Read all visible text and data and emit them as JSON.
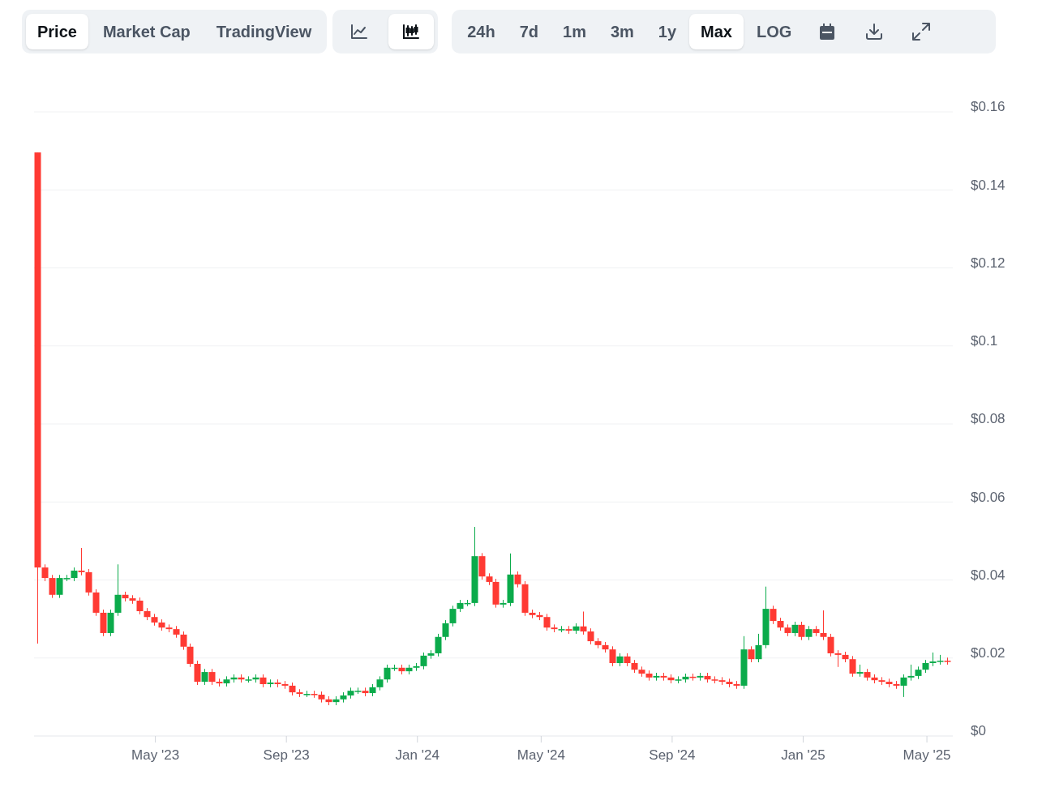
{
  "view_tabs": [
    {
      "label": "Price",
      "selected": true
    },
    {
      "label": "Market Cap",
      "selected": false
    },
    {
      "label": "TradingView",
      "selected": false
    }
  ],
  "chart_type_buttons": [
    {
      "kind": "line",
      "selected": false
    },
    {
      "kind": "candlestick",
      "selected": true
    }
  ],
  "range_tabs": [
    {
      "label": "24h",
      "selected": false
    },
    {
      "label": "7d",
      "selected": false
    },
    {
      "label": "1m",
      "selected": false
    },
    {
      "label": "3m",
      "selected": false
    },
    {
      "label": "1y",
      "selected": false
    },
    {
      "label": "Max",
      "selected": true
    },
    {
      "label": "LOG",
      "selected": false
    }
  ],
  "tool_buttons": [
    {
      "kind": "calendar"
    },
    {
      "kind": "download"
    },
    {
      "kind": "fullscreen"
    }
  ],
  "chart": {
    "chart_data": {
      "type": "candlestick",
      "grid": true,
      "ylim": [
        0,
        0.16
      ],
      "yticks": [
        {
          "value": 0.16,
          "label": "$0.16"
        },
        {
          "value": 0.14,
          "label": "$0.14"
        },
        {
          "value": 0.12,
          "label": "$0.12"
        },
        {
          "value": 0.1,
          "label": "$0.1"
        },
        {
          "value": 0.08,
          "label": "$0.08"
        },
        {
          "value": 0.06,
          "label": "$0.06"
        },
        {
          "value": 0.04,
          "label": "$0.04"
        },
        {
          "value": 0.02,
          "label": "$0.02"
        },
        {
          "value": 0,
          "label": "$0"
        }
      ],
      "categories": [
        null,
        null,
        null,
        null,
        null,
        null,
        null,
        null,
        null,
        null,
        null,
        null,
        null,
        null,
        null,
        null,
        "May '23",
        null,
        null,
        null,
        null,
        null,
        null,
        null,
        null,
        null,
        null,
        null,
        null,
        null,
        null,
        null,
        null,
        null,
        "Sep '23",
        null,
        null,
        null,
        null,
        null,
        null,
        null,
        null,
        null,
        null,
        null,
        null,
        null,
        null,
        null,
        null,
        null,
        "Jan '24",
        null,
        null,
        null,
        null,
        null,
        null,
        null,
        null,
        null,
        null,
        null,
        null,
        null,
        null,
        null,
        null,
        "May '24",
        null,
        null,
        null,
        null,
        null,
        null,
        null,
        null,
        null,
        null,
        null,
        null,
        null,
        null,
        null,
        null,
        null,
        "Sep '24",
        null,
        null,
        null,
        null,
        null,
        null,
        null,
        null,
        null,
        null,
        null,
        null,
        null,
        null,
        null,
        null,
        null,
        "Jan '25",
        null,
        null,
        null,
        null,
        null,
        null,
        null,
        null,
        null,
        null,
        null,
        null,
        null,
        null,
        null,
        null,
        "May '25",
        null,
        null,
        null
      ],
      "ohlc": [
        [
          0.1496,
          0.1496,
          0.0237,
          0.0432
        ],
        [
          0.0432,
          0.044,
          0.0397,
          0.0405
        ],
        [
          0.0405,
          0.0413,
          0.0354,
          0.0362
        ],
        [
          0.0362,
          0.0413,
          0.0354,
          0.0405
        ],
        [
          0.0405,
          0.0413,
          0.0397,
          0.0405
        ],
        [
          0.0405,
          0.0432,
          0.0397,
          0.0424
        ],
        [
          0.0424,
          0.0482,
          0.0412,
          0.042
        ],
        [
          0.042,
          0.0428,
          0.036,
          0.0368
        ],
        [
          0.0368,
          0.0376,
          0.0308,
          0.0316
        ],
        [
          0.0316,
          0.0324,
          0.0256,
          0.0264
        ],
        [
          0.0264,
          0.0324,
          0.0256,
          0.0316
        ],
        [
          0.0316,
          0.044,
          0.0308,
          0.0362
        ],
        [
          0.0362,
          0.037,
          0.0345,
          0.0353
        ],
        [
          0.0353,
          0.0361,
          0.0339,
          0.0347
        ],
        [
          0.0347,
          0.0355,
          0.0312,
          0.032
        ],
        [
          0.032,
          0.0328,
          0.0297,
          0.0305
        ],
        [
          0.0305,
          0.0313,
          0.0283,
          0.0291
        ],
        [
          0.0291,
          0.0299,
          0.027,
          0.0278
        ],
        [
          0.0278,
          0.0286,
          0.0266,
          0.0274
        ],
        [
          0.0274,
          0.0282,
          0.0252,
          0.026
        ],
        [
          0.026,
          0.0268,
          0.0221,
          0.0229
        ],
        [
          0.0229,
          0.0237,
          0.0177,
          0.0185
        ],
        [
          0.0185,
          0.0193,
          0.0131,
          0.0139
        ],
        [
          0.0139,
          0.0172,
          0.0131,
          0.0164
        ],
        [
          0.0164,
          0.0172,
          0.0131,
          0.0139
        ],
        [
          0.0139,
          0.0147,
          0.0127,
          0.0135
        ],
        [
          0.0135,
          0.0153,
          0.0127,
          0.0145
        ],
        [
          0.0145,
          0.0158,
          0.0137,
          0.015
        ],
        [
          0.015,
          0.0158,
          0.0137,
          0.0145
        ],
        [
          0.0145,
          0.0153,
          0.0137,
          0.0145
        ],
        [
          0.0145,
          0.0158,
          0.0137,
          0.015
        ],
        [
          0.015,
          0.0158,
          0.0125,
          0.0133
        ],
        [
          0.0133,
          0.0145,
          0.0125,
          0.0137
        ],
        [
          0.0137,
          0.0145,
          0.0125,
          0.0133
        ],
        [
          0.0133,
          0.0141,
          0.0121,
          0.0129
        ],
        [
          0.0129,
          0.0137,
          0.0104,
          0.0112
        ],
        [
          0.0112,
          0.012,
          0.01,
          0.0108
        ],
        [
          0.0108,
          0.0116,
          0.01,
          0.0108
        ],
        [
          0.0108,
          0.0116,
          0.0098,
          0.0106
        ],
        [
          0.0106,
          0.0114,
          0.0086,
          0.0094
        ],
        [
          0.0094,
          0.0102,
          0.0079,
          0.0087
        ],
        [
          0.0087,
          0.0102,
          0.0079,
          0.0094
        ],
        [
          0.0094,
          0.0112,
          0.0086,
          0.0104
        ],
        [
          0.0104,
          0.0124,
          0.0096,
          0.0116
        ],
        [
          0.0116,
          0.0124,
          0.0108,
          0.0116
        ],
        [
          0.0116,
          0.0124,
          0.0102,
          0.011
        ],
        [
          0.011,
          0.0133,
          0.0102,
          0.0125
        ],
        [
          0.0125,
          0.0153,
          0.0117,
          0.0145
        ],
        [
          0.0145,
          0.0183,
          0.0137,
          0.0175
        ],
        [
          0.0175,
          0.0183,
          0.0167,
          0.0175
        ],
        [
          0.0175,
          0.0183,
          0.0158,
          0.0166
        ],
        [
          0.0166,
          0.0183,
          0.0158,
          0.0175
        ],
        [
          0.0175,
          0.0187,
          0.0167,
          0.0179
        ],
        [
          0.0179,
          0.0214,
          0.0171,
          0.0206
        ],
        [
          0.0206,
          0.022,
          0.0198,
          0.0212
        ],
        [
          0.0212,
          0.0262,
          0.0204,
          0.0254
        ],
        [
          0.0254,
          0.0297,
          0.0246,
          0.0289
        ],
        [
          0.0289,
          0.0334,
          0.0281,
          0.0326
        ],
        [
          0.0326,
          0.0349,
          0.0318,
          0.0341
        ],
        [
          0.0341,
          0.0349,
          0.0333,
          0.0341
        ],
        [
          0.0341,
          0.0536,
          0.0333,
          0.0461
        ],
        [
          0.0461,
          0.0469,
          0.0401,
          0.0409
        ],
        [
          0.0409,
          0.0417,
          0.0387,
          0.0395
        ],
        [
          0.0395,
          0.0403,
          0.0329,
          0.0337
        ],
        [
          0.0337,
          0.0349,
          0.0329,
          0.0341
        ],
        [
          0.0341,
          0.0468,
          0.0333,
          0.0414
        ],
        [
          0.0414,
          0.0422,
          0.0381,
          0.0389
        ],
        [
          0.0389,
          0.0397,
          0.0308,
          0.0316
        ],
        [
          0.0316,
          0.0324,
          0.0302,
          0.031
        ],
        [
          0.031,
          0.0318,
          0.0297,
          0.0305
        ],
        [
          0.0305,
          0.0313,
          0.027,
          0.0278
        ],
        [
          0.0278,
          0.0286,
          0.0266,
          0.0274
        ],
        [
          0.0274,
          0.0282,
          0.0266,
          0.0274
        ],
        [
          0.0274,
          0.0282,
          0.0262,
          0.027
        ],
        [
          0.027,
          0.0289,
          0.0262,
          0.0281
        ],
        [
          0.0281,
          0.0319,
          0.026,
          0.0268
        ],
        [
          0.0268,
          0.0276,
          0.0235,
          0.0243
        ],
        [
          0.0243,
          0.0251,
          0.0225,
          0.0233
        ],
        [
          0.0233,
          0.0241,
          0.0214,
          0.0222
        ],
        [
          0.0222,
          0.023,
          0.0179,
          0.0187
        ],
        [
          0.0187,
          0.0212,
          0.0179,
          0.0204
        ],
        [
          0.0204,
          0.0212,
          0.0179,
          0.0187
        ],
        [
          0.0187,
          0.0195,
          0.0162,
          0.017
        ],
        [
          0.017,
          0.0178,
          0.0152,
          0.016
        ],
        [
          0.016,
          0.0168,
          0.0142,
          0.015
        ],
        [
          0.015,
          0.0162,
          0.0142,
          0.0154
        ],
        [
          0.0154,
          0.0162,
          0.0142,
          0.015
        ],
        [
          0.015,
          0.0158,
          0.0135,
          0.0143
        ],
        [
          0.0143,
          0.0153,
          0.0135,
          0.0145
        ],
        [
          0.0145,
          0.016,
          0.0137,
          0.0152
        ],
        [
          0.0152,
          0.016,
          0.0142,
          0.015
        ],
        [
          0.015,
          0.0162,
          0.0142,
          0.0154
        ],
        [
          0.0154,
          0.0162,
          0.0137,
          0.0145
        ],
        [
          0.0145,
          0.0153,
          0.0135,
          0.0143
        ],
        [
          0.0143,
          0.0151,
          0.0131,
          0.0139
        ],
        [
          0.0139,
          0.0147,
          0.0125,
          0.0133
        ],
        [
          0.0133,
          0.0141,
          0.0121,
          0.0129
        ],
        [
          0.0129,
          0.0256,
          0.0121,
          0.0222
        ],
        [
          0.0222,
          0.023,
          0.0189,
          0.0197
        ],
        [
          0.0197,
          0.0262,
          0.0189,
          0.0233
        ],
        [
          0.0233,
          0.0383,
          0.0225,
          0.0326
        ],
        [
          0.0326,
          0.0334,
          0.0287,
          0.0295
        ],
        [
          0.0295,
          0.0303,
          0.027,
          0.0278
        ],
        [
          0.0278,
          0.0286,
          0.0256,
          0.0264
        ],
        [
          0.0264,
          0.0293,
          0.0256,
          0.0285
        ],
        [
          0.0285,
          0.0293,
          0.0246,
          0.0254
        ],
        [
          0.0254,
          0.0282,
          0.0246,
          0.0274
        ],
        [
          0.0274,
          0.0282,
          0.0256,
          0.0264
        ],
        [
          0.0264,
          0.0322,
          0.0246,
          0.0254
        ],
        [
          0.0254,
          0.0262,
          0.0204,
          0.0212
        ],
        [
          0.0212,
          0.022,
          0.0177,
          0.0208
        ],
        [
          0.0208,
          0.0216,
          0.0189,
          0.0197
        ],
        [
          0.0197,
          0.0205,
          0.0152,
          0.016
        ],
        [
          0.016,
          0.0183,
          0.0152,
          0.0164
        ],
        [
          0.0164,
          0.0172,
          0.0142,
          0.015
        ],
        [
          0.015,
          0.0158,
          0.0135,
          0.0143
        ],
        [
          0.0143,
          0.0151,
          0.0131,
          0.0139
        ],
        [
          0.0139,
          0.0147,
          0.0125,
          0.0133
        ],
        [
          0.0133,
          0.0141,
          0.0121,
          0.0129
        ],
        [
          0.0129,
          0.0158,
          0.01,
          0.015
        ],
        [
          0.015,
          0.0183,
          0.0142,
          0.0154
        ],
        [
          0.0154,
          0.0178,
          0.0146,
          0.017
        ],
        [
          0.017,
          0.0195,
          0.0162,
          0.0187
        ],
        [
          0.0187,
          0.0214,
          0.0179,
          0.0191
        ],
        [
          0.0191,
          0.0208,
          0.0183,
          0.0193
        ],
        [
          0.0193,
          0.0201,
          0.0183,
          0.0191
        ]
      ]
    }
  }
}
